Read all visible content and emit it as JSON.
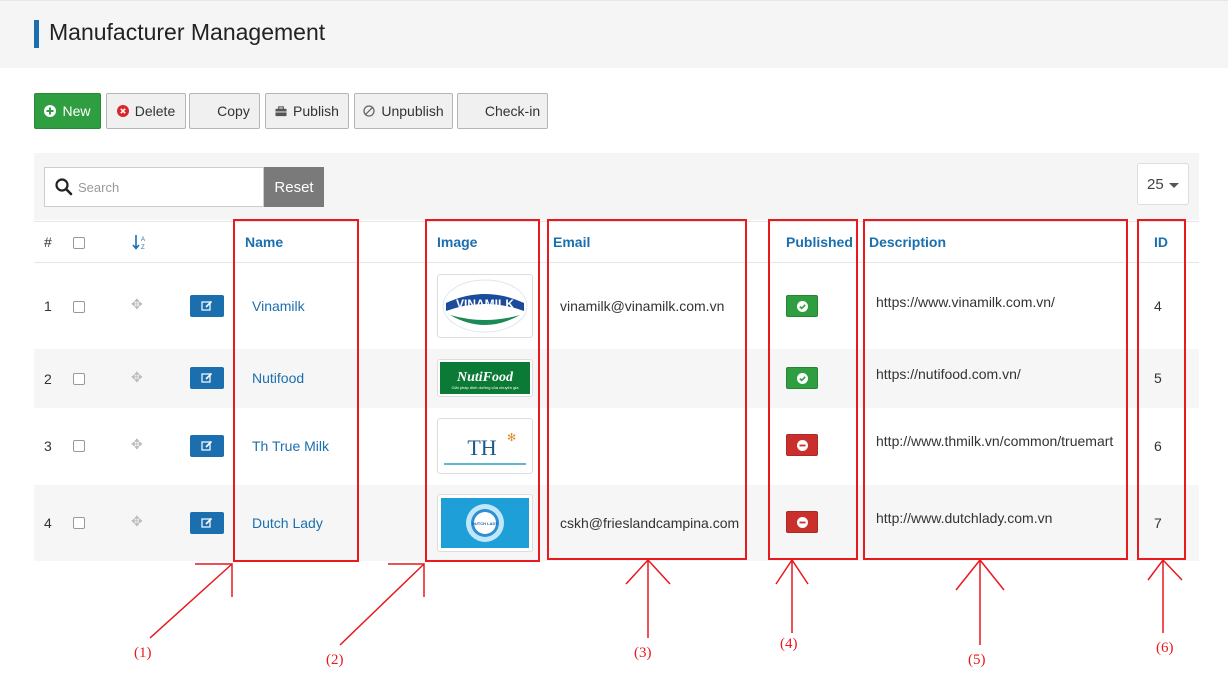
{
  "page": {
    "title": "Manufacturer Management"
  },
  "toolbar": {
    "new": "New",
    "delete": "Delete",
    "copy": "Copy",
    "publish": "Publish",
    "unpublish": "Unpublish",
    "checkin": "Check-in"
  },
  "filter": {
    "search_placeholder": "Search",
    "reset": "Reset",
    "limit": "25"
  },
  "table": {
    "headers": {
      "num": "#",
      "name": "Name",
      "image": "Image",
      "email": "Email",
      "published": "Published",
      "description": "Description",
      "id": "ID"
    },
    "rows": [
      {
        "num": "1",
        "name": "Vinamilk",
        "email": "vinamilk@vinamilk.com.vn",
        "published": true,
        "description": "https://www.vinamilk.com.vn/",
        "id": "4",
        "logo_text": "VINAMILK"
      },
      {
        "num": "2",
        "name": "Nutifood",
        "email": "",
        "published": true,
        "description": "https://nutifood.com.vn/",
        "id": "5",
        "logo_text": "NutiFood",
        "logo_sub": "Giải pháp dinh dưỡng của chuyên gia"
      },
      {
        "num": "3",
        "name": "Th True Milk",
        "email": "",
        "published": false,
        "description": "http://www.thmilk.vn/common/truemart",
        "id": "6",
        "logo_text": "TH"
      },
      {
        "num": "4",
        "name": "Dutch Lady",
        "email": "cskh@frieslandcampina.com",
        "published": false,
        "description": "http://www.dutchlady.com.vn",
        "id": "7",
        "logo_text": "DUTCH LADY"
      }
    ]
  },
  "annotations": [
    "(1)",
    "(2)",
    "(3)",
    "(4)",
    "(5)",
    "(6)"
  ],
  "colors": {
    "primary": "#1b6fae",
    "success": "#2f9e41",
    "danger": "#c9302c",
    "annotation": "#e8191f"
  }
}
